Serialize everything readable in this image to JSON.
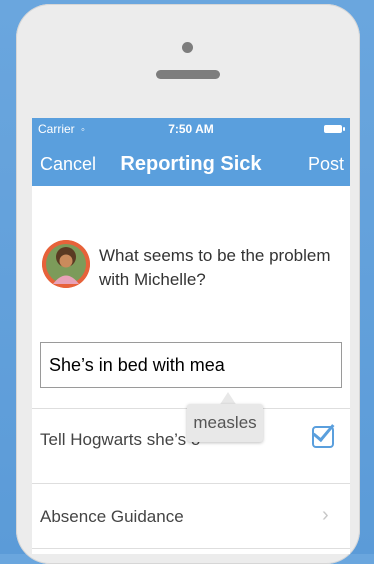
{
  "status_bar": {
    "carrier": "Carrier",
    "time": "7:50 AM"
  },
  "nav": {
    "cancel_label": "Cancel",
    "title": "Reporting Sick",
    "post_label": "Post"
  },
  "prompt": {
    "question": "What seems to be the problem with Michelle?"
  },
  "input": {
    "value": "She’s in bed with mea"
  },
  "autocomplete": {
    "suggestion": "measles"
  },
  "rows": [
    {
      "label": "Tell Hogwarts she’s o",
      "checked": true
    },
    {
      "label": "Absence Guidance"
    }
  ],
  "colors": {
    "accent": "#5a9fdd",
    "background": "#6aa6de",
    "avatar_ring": "#e7623a"
  },
  "icons": [
    "wifi-icon",
    "battery-icon",
    "checkbox-checked-icon",
    "chevron-right-icon"
  ]
}
